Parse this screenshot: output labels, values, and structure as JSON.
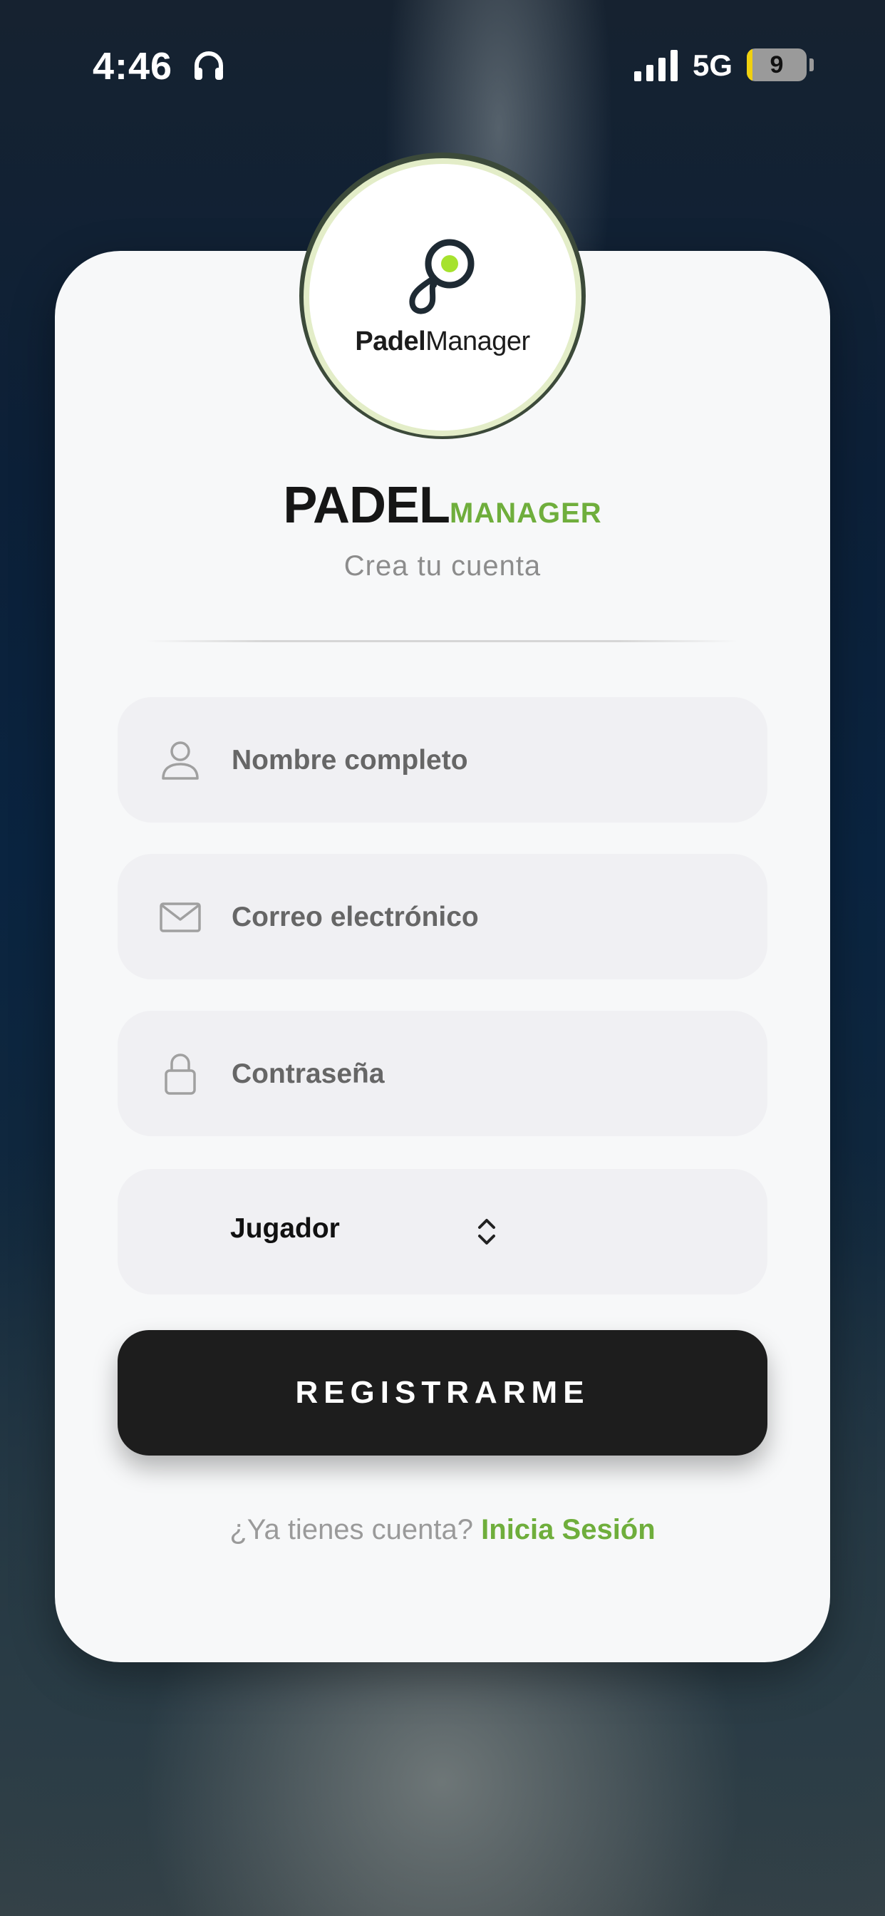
{
  "status_bar": {
    "time": "4:46",
    "network": "5G",
    "battery": "9",
    "battery_level_percent": 9
  },
  "app": {
    "logo_text_bold": "Padel",
    "logo_text_regular": "Manager",
    "brand_primary": "PADEL",
    "brand_secondary": "MANAGER",
    "subtitle": "Crea tu cuenta",
    "accent_color": "#6fae3c"
  },
  "form": {
    "name_placeholder": "Nombre completo",
    "email_placeholder": "Correo electrónico",
    "password_placeholder": "Contraseña",
    "role_selected": "Jugador",
    "submit_label": "REGISTRARME"
  },
  "footer": {
    "question": "¿Ya tienes cuenta?",
    "login_link": "Inicia Sesión"
  },
  "icons": [
    "headphones-icon",
    "signal-icon",
    "battery-icon",
    "user-icon",
    "mail-icon",
    "lock-icon",
    "chevron-updown-icon"
  ]
}
